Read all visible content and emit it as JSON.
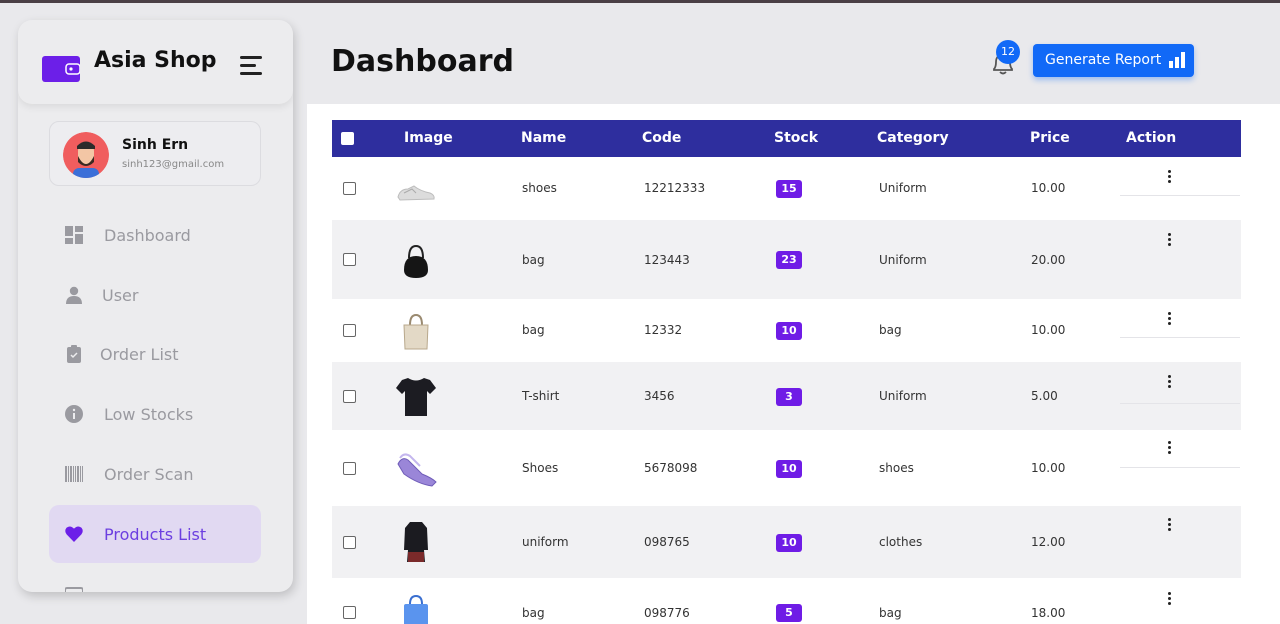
{
  "brand": {
    "name": "Asia Shop",
    "logo_icon": "wallet-icon",
    "accent": "#6c1fe8"
  },
  "profile": {
    "name": "Sinh Ern",
    "email": "sinh123@gmail.com"
  },
  "nav": [
    {
      "label": "Dashboard",
      "icon": "grid-icon",
      "active": false
    },
    {
      "label": "User",
      "icon": "user-icon",
      "active": false
    },
    {
      "label": "Order List",
      "icon": "clipboard-icon",
      "active": false
    },
    {
      "label": "Low Stocks",
      "icon": "info-icon",
      "active": false
    },
    {
      "label": "Order Scan",
      "icon": "barcode-icon",
      "active": false
    },
    {
      "label": "Products List",
      "icon": "heart-icon",
      "active": true
    }
  ],
  "header": {
    "title": "Dashboard",
    "notification_count": "12",
    "report_button": "Generate Report"
  },
  "table": {
    "columns": [
      "Image",
      "Name",
      "Code",
      "Stock",
      "Category",
      "Price",
      "Action"
    ],
    "rows": [
      {
        "image": "shoes-image",
        "name": "shoes",
        "code": "12212333",
        "stock": "15",
        "category": "Uniform",
        "price": "10.00"
      },
      {
        "image": "bag-image",
        "name": "bag",
        "code": "123443",
        "stock": "23",
        "category": "Uniform",
        "price": "20.00"
      },
      {
        "image": "tote-bag-image",
        "name": "bag",
        "code": "12332",
        "stock": "10",
        "category": "bag",
        "price": "10.00"
      },
      {
        "image": "tshirt-image",
        "name": "T-shirt",
        "code": "3456",
        "stock": "3",
        "category": "Uniform",
        "price": "5.00"
      },
      {
        "image": "sneakers-image",
        "name": "Shoes",
        "code": "5678098",
        "stock": "10",
        "category": "shoes",
        "price": "10.00"
      },
      {
        "image": "uniform-image",
        "name": "uniform",
        "code": "098765",
        "stock": "10",
        "category": "clothes",
        "price": "12.00"
      },
      {
        "image": "blue-bag-image",
        "name": "bag",
        "code": "098776",
        "stock": "5",
        "category": "bag",
        "price": "18.00"
      }
    ]
  },
  "colors": {
    "table_header": "#2e2e9e",
    "stock_badge": "#6f1ce6",
    "primary_button": "#1169f7",
    "active_nav_bg": "#e1d9f2"
  }
}
